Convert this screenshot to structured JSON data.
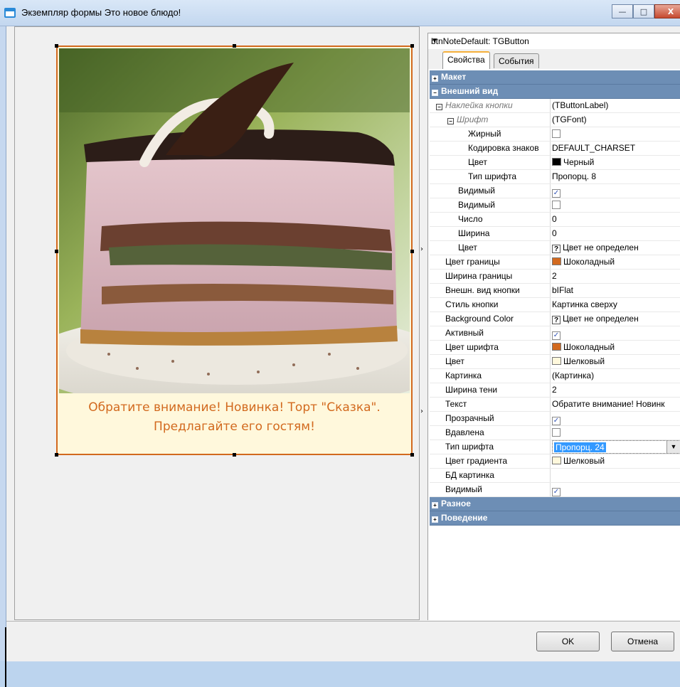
{
  "window": {
    "title": "Экземпляр формы Это новое блюдо!",
    "min_glyph": "—",
    "max_glyph": "□",
    "close_glyph": "X"
  },
  "preview": {
    "caption_line1": "Обратите внимание! Новинка! Торт \"Сказка\".",
    "caption_line2": "Предлагайте его гостям!",
    "border_color": "#d2691e",
    "background_color": "#fff8dc"
  },
  "inspector": {
    "selected_component": "btnNoteDefault: TGButton",
    "tabs": [
      {
        "label": "Свойства"
      },
      {
        "label": "События"
      }
    ],
    "rows": [
      {
        "kind": "cat",
        "toggle": "+",
        "name": "Макет"
      },
      {
        "kind": "cat",
        "toggle": "−",
        "name": "Внешний вид"
      },
      {
        "kind": "prop",
        "indent": 0,
        "toggle": "−",
        "italic": true,
        "name": "Наклейка кнопки",
        "value": "(TButtonLabel)"
      },
      {
        "kind": "prop",
        "indent": 1,
        "toggle": "−",
        "italic": true,
        "name": "Шрифт",
        "value": "(TGFont)"
      },
      {
        "kind": "prop",
        "indent": 3,
        "name": "Жирный",
        "check": false
      },
      {
        "kind": "prop",
        "indent": 3,
        "name": "Кодировка знаков",
        "value": "DEFAULT_CHARSET"
      },
      {
        "kind": "prop",
        "indent": 3,
        "name": "Цвет",
        "swatch": "#000000",
        "value": "Черный"
      },
      {
        "kind": "prop",
        "indent": 3,
        "name": "Тип шрифта",
        "value": "Пропорц. 8"
      },
      {
        "kind": "prop",
        "indent": 2,
        "name": "Видимый",
        "check": true
      },
      {
        "kind": "prop",
        "indent": 2,
        "name": "Видимый",
        "check": false
      },
      {
        "kind": "prop",
        "indent": 2,
        "name": "Число",
        "value": "0"
      },
      {
        "kind": "prop",
        "indent": 2,
        "name": "Ширина",
        "value": "0"
      },
      {
        "kind": "prop",
        "indent": 2,
        "name": "Цвет",
        "question": "?",
        "value": "Цвет не определен"
      },
      {
        "kind": "prop",
        "indent": 0,
        "name": "Цвет границы",
        "swatch": "#d2691e",
        "value": "Шоколадный"
      },
      {
        "kind": "prop",
        "indent": 0,
        "name": "Ширина границы",
        "value": "2"
      },
      {
        "kind": "prop",
        "indent": 0,
        "name": "Внешн. вид кнопки",
        "value": "bIFlat"
      },
      {
        "kind": "prop",
        "indent": 0,
        "name": "Стиль кнопки",
        "value": "Картинка сверху"
      },
      {
        "kind": "prop",
        "indent": 0,
        "name": "Background Color",
        "question": "?",
        "value": "Цвет не определен"
      },
      {
        "kind": "prop",
        "indent": 0,
        "name": "Активный",
        "check": true
      },
      {
        "kind": "prop",
        "indent": 0,
        "name": "Цвет шрифта",
        "swatch": "#d2691e",
        "value": "Шоколадный"
      },
      {
        "kind": "prop",
        "indent": 0,
        "name": "Цвет",
        "swatch": "#fff8dc",
        "value": "Шелковый"
      },
      {
        "kind": "prop",
        "indent": 0,
        "name": "Картинка",
        "value": "(Картинка)"
      },
      {
        "kind": "prop",
        "indent": 0,
        "name": "Ширина тени",
        "value": "2"
      },
      {
        "kind": "prop",
        "indent": 0,
        "name": "Текст",
        "value": "Обратите внимание! Новинк"
      },
      {
        "kind": "prop",
        "indent": 0,
        "name": "Прозрачный",
        "check": true
      },
      {
        "kind": "prop",
        "indent": 0,
        "name": "Вдавлена",
        "check": false
      },
      {
        "kind": "prop",
        "indent": 0,
        "name": "Тип шрифта",
        "editing": true,
        "value": "Пропорц. 24"
      },
      {
        "kind": "prop",
        "indent": 0,
        "name": "Цвет градиента",
        "swatch": "#fff8dc",
        "value": "Шелковый"
      },
      {
        "kind": "prop",
        "indent": 0,
        "name": "БД картинка",
        "value": ""
      },
      {
        "kind": "prop",
        "indent": 0,
        "name": "Видимый",
        "check": true
      },
      {
        "kind": "cat",
        "toggle": "+",
        "name": "Разное"
      },
      {
        "kind": "cat",
        "toggle": "+",
        "name": "Поведение"
      }
    ]
  },
  "buttons": {
    "ok": "OK",
    "cancel": "Отмена"
  }
}
